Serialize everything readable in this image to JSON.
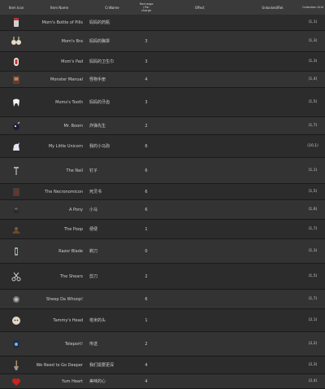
{
  "header": {
    "col_icon": "Item Icon",
    "col_name": "Item Name",
    "col_cn": "CnName",
    "col_recharge": "Recharge / Re-charge",
    "col_effect": "Effect",
    "col_unlock": "Unlocked/Rel.",
    "col_collection": "Collection Grid"
  },
  "rows": [
    {
      "name": "Mom's Bottle of Pills",
      "cn": "妈妈的药瓶",
      "charge": "",
      "effect": "",
      "unlock": "",
      "grid": "(1,1)",
      "icon": "pill-bottle-icon"
    },
    {
      "name": "Mom's Bra",
      "cn": "妈妈的胸罩",
      "charge": "3",
      "effect": "",
      "unlock": "",
      "grid": "(1,3)",
      "icon": "bra-icon"
    },
    {
      "name": "Mom's Pad",
      "cn": "妈妈的卫生巾",
      "charge": "3",
      "effect": "",
      "unlock": "",
      "grid": "(1,3)",
      "icon": "pad-icon"
    },
    {
      "name": "Monster Manual",
      "cn": "怪物手册",
      "charge": "4",
      "effect": "",
      "unlock": "",
      "grid": "(1,4)",
      "icon": "book-icon"
    },
    {
      "name": "Moms's Tooth",
      "cn": "妈妈的牙齿",
      "charge": "3",
      "effect": "",
      "unlock": "",
      "grid": "(1,5)",
      "icon": "tooth-icon"
    },
    {
      "name": "Mr. Boom",
      "cn": "炸弹先生",
      "charge": "2",
      "effect": "",
      "unlock": "",
      "grid": "(1,7)",
      "icon": "bomb-icon"
    },
    {
      "name": "My Little Unicorn",
      "cn": "我的小马驹",
      "charge": "6",
      "effect": "",
      "unlock": "",
      "grid": "(10,1)",
      "icon": "unicorn-icon"
    },
    {
      "name": "The Nail",
      "cn": "钉子",
      "charge": "6",
      "effect": "",
      "unlock": "",
      "grid": "(1,1)",
      "icon": "nail-icon"
    },
    {
      "name": "The Necronomicon",
      "cn": "死灵书",
      "charge": "6",
      "effect": "",
      "unlock": "",
      "grid": "(1,5)",
      "icon": "necronomicon-icon"
    },
    {
      "name": "A Pony",
      "cn": "小马",
      "charge": "6",
      "effect": "",
      "unlock": "",
      "grid": "(1,6)",
      "icon": "pony-icon"
    },
    {
      "name": "The Poop",
      "cn": "便便",
      "charge": "1",
      "effect": "",
      "unlock": "",
      "grid": "(1,7)",
      "icon": "poop-icon"
    },
    {
      "name": "Razor Blade",
      "cn": "剃刀",
      "charge": "0",
      "effect": "",
      "unlock": "",
      "grid": "(1,3)",
      "icon": "razor-icon"
    },
    {
      "name": "The Shears",
      "cn": "剪刀",
      "charge": "2",
      "effect": "",
      "unlock": "",
      "grid": "(1,5)",
      "icon": "shears-icon"
    },
    {
      "name": "Sheep Da Whoop!",
      "cn": "",
      "charge": "6",
      "effect": "",
      "unlock": "",
      "grid": "(1,7)",
      "icon": "sheep-icon"
    },
    {
      "name": "Tammy's Head",
      "cn": "塔米的头",
      "charge": "1",
      "effect": "",
      "unlock": "",
      "grid": "(2,1)",
      "icon": "tammy-head-icon"
    },
    {
      "name": "Teleport!",
      "cn": "传送",
      "charge": "2",
      "effect": "",
      "unlock": "",
      "grid": "(2,2)",
      "icon": "teleport-icon"
    },
    {
      "name": "We Need to Go Deeper",
      "cn": "我们需要更深",
      "charge": "4",
      "effect": "",
      "unlock": "",
      "grid": "(2,3)",
      "icon": "shovel-icon"
    },
    {
      "name": "Yum Heart",
      "cn": "美味的心",
      "charge": "4",
      "effect": "",
      "unlock": "",
      "grid": "(2,4)",
      "icon": "heart-icon"
    }
  ],
  "colors": {
    "bg": "#262626",
    "row_a": "#2c2c2c",
    "row_b": "#333333",
    "header": "#3a3a3a",
    "text": "#cfcfcf"
  }
}
